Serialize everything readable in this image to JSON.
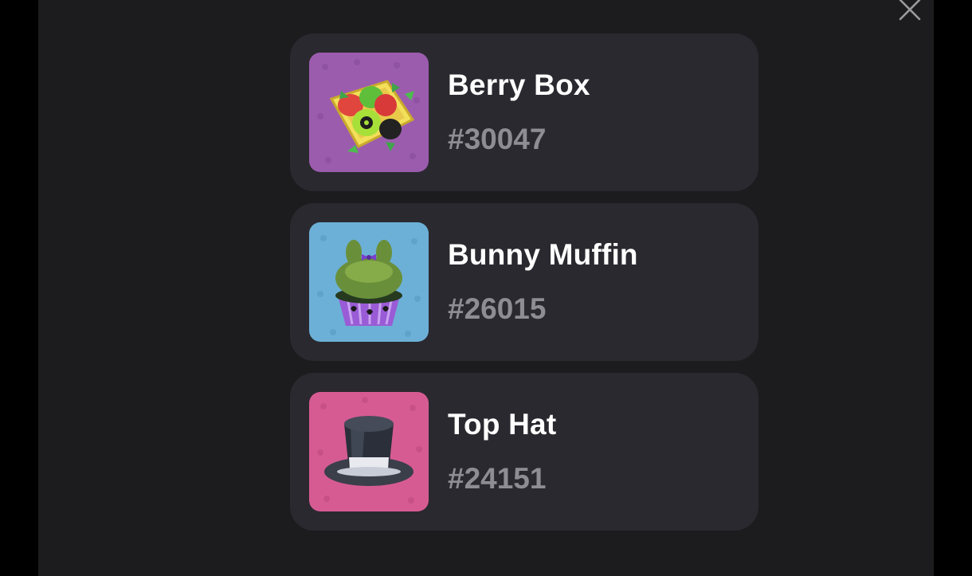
{
  "dialog": {
    "close_icon": "close-icon"
  },
  "items": [
    {
      "name": "Berry Box",
      "number": "#30047",
      "thumb_bg": "#a05fb0",
      "icon": "berry-box-icon"
    },
    {
      "name": "Bunny Muffin",
      "number": "#26015",
      "thumb_bg": "#6fb0d6",
      "icon": "bunny-muffin-icon"
    },
    {
      "name": "Top Hat",
      "number": "#24151",
      "thumb_bg": "#d95b94",
      "icon": "top-hat-icon"
    }
  ]
}
